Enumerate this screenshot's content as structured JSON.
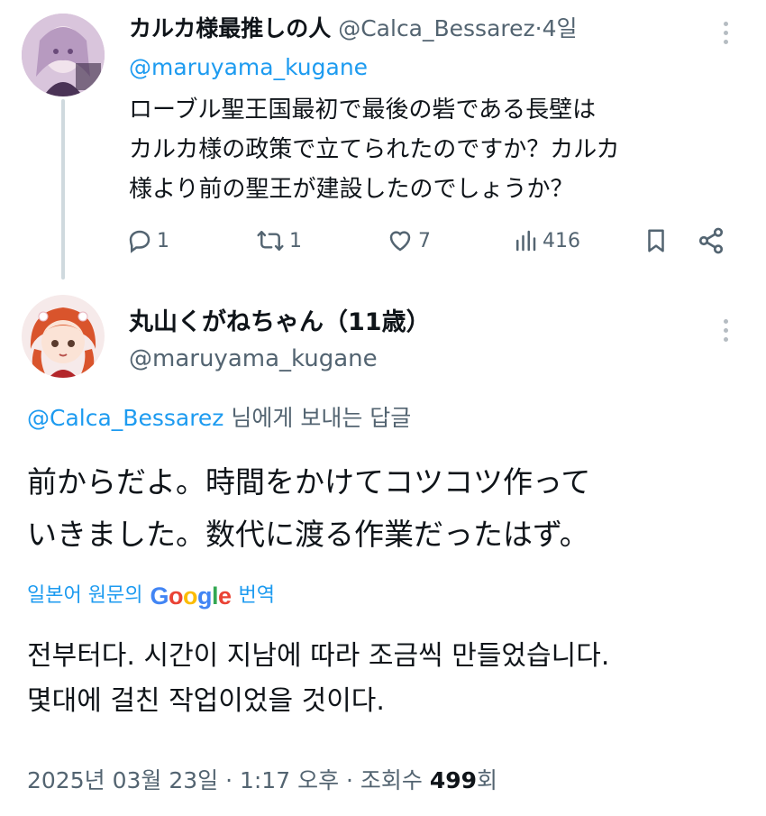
{
  "parent_tweet": {
    "author_name": "カルカ様最推しの人",
    "author_handle": "@Calca_Bessarez",
    "separator": "·",
    "time": "4일",
    "replying_to": "@maruyama_kugane",
    "text_lines": [
      "ローブル聖王国最初で最後の砦である長壁は",
      "カルカ様の政策で立てられたのですか？カルカ",
      "様より前の聖王が建設したのでしょうか？"
    ],
    "actions": {
      "reply_count": "1",
      "retweet_count": "1",
      "like_count": "7",
      "view_count": "416"
    },
    "icons": [
      "reply-icon",
      "retweet-icon",
      "like-icon",
      "views-icon",
      "bookmark-icon",
      "share-icon"
    ]
  },
  "main_tweet": {
    "author_name": "丸山くがねちゃん（11歳）",
    "author_handle": "@maruyama_kugane",
    "replying_mention": "@Calca_Bessarez",
    "replying_suffix": " 님에게 보내는 답글",
    "text_lines": [
      "前からだよ。時間をかけてコツコツ作って",
      "いきました。数代に渡る作業だったはず。"
    ],
    "translate_prefix": "일본어 원문의",
    "translate_brand": "Google",
    "translate_suffix": "번역",
    "translated_lines": [
      "전부터다. 시간이 지남에 따라 조금씩 만들었습니다.",
      "몇대에 걸친 작업이었을 것이다."
    ],
    "timestamp": "2025년 03월 23일 · 1:17 오후 · 조회수 ",
    "views": "499",
    "views_suffix": "회"
  },
  "colors": {
    "accent": "#1d9bf0",
    "secondary_text": "#536471",
    "primary_text": "#0f1419",
    "thread_line": "#cfd9de"
  }
}
